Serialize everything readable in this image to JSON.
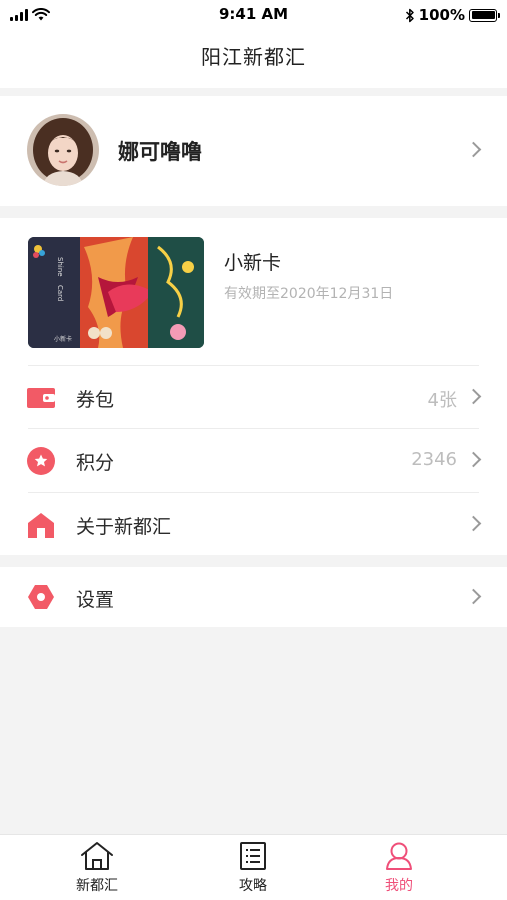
{
  "status_bar": {
    "time": "9:41 AM",
    "battery": "100%"
  },
  "header": {
    "title": "阳江新都汇"
  },
  "profile": {
    "name": "娜可噜噜"
  },
  "card": {
    "name": "小新卡",
    "expiry": "有效期至2020年12月31日",
    "art_text": {
      "brand": "Shine",
      "type": "Card",
      "footer": "小新卡"
    }
  },
  "menu": {
    "items": [
      {
        "label": "券包",
        "value": "4张",
        "icon": "wallet-icon"
      },
      {
        "label": "积分",
        "value": "2346",
        "icon": "star-badge-icon"
      },
      {
        "label": "关于新都汇",
        "value": "",
        "icon": "building-icon"
      }
    ],
    "settings": {
      "label": "设置",
      "icon": "gear-hexagon-icon"
    }
  },
  "tab_bar": {
    "tabs": [
      {
        "label": "新都汇",
        "icon": "home-icon"
      },
      {
        "label": "攻略",
        "icon": "list-icon"
      },
      {
        "label": "我的",
        "icon": "person-icon"
      }
    ],
    "active_index": 2
  },
  "colors": {
    "accent": "#ef4f79",
    "icon_red": "#f25a66",
    "text_secondary": "#b3b3b3",
    "background": "#f3f3f3"
  }
}
